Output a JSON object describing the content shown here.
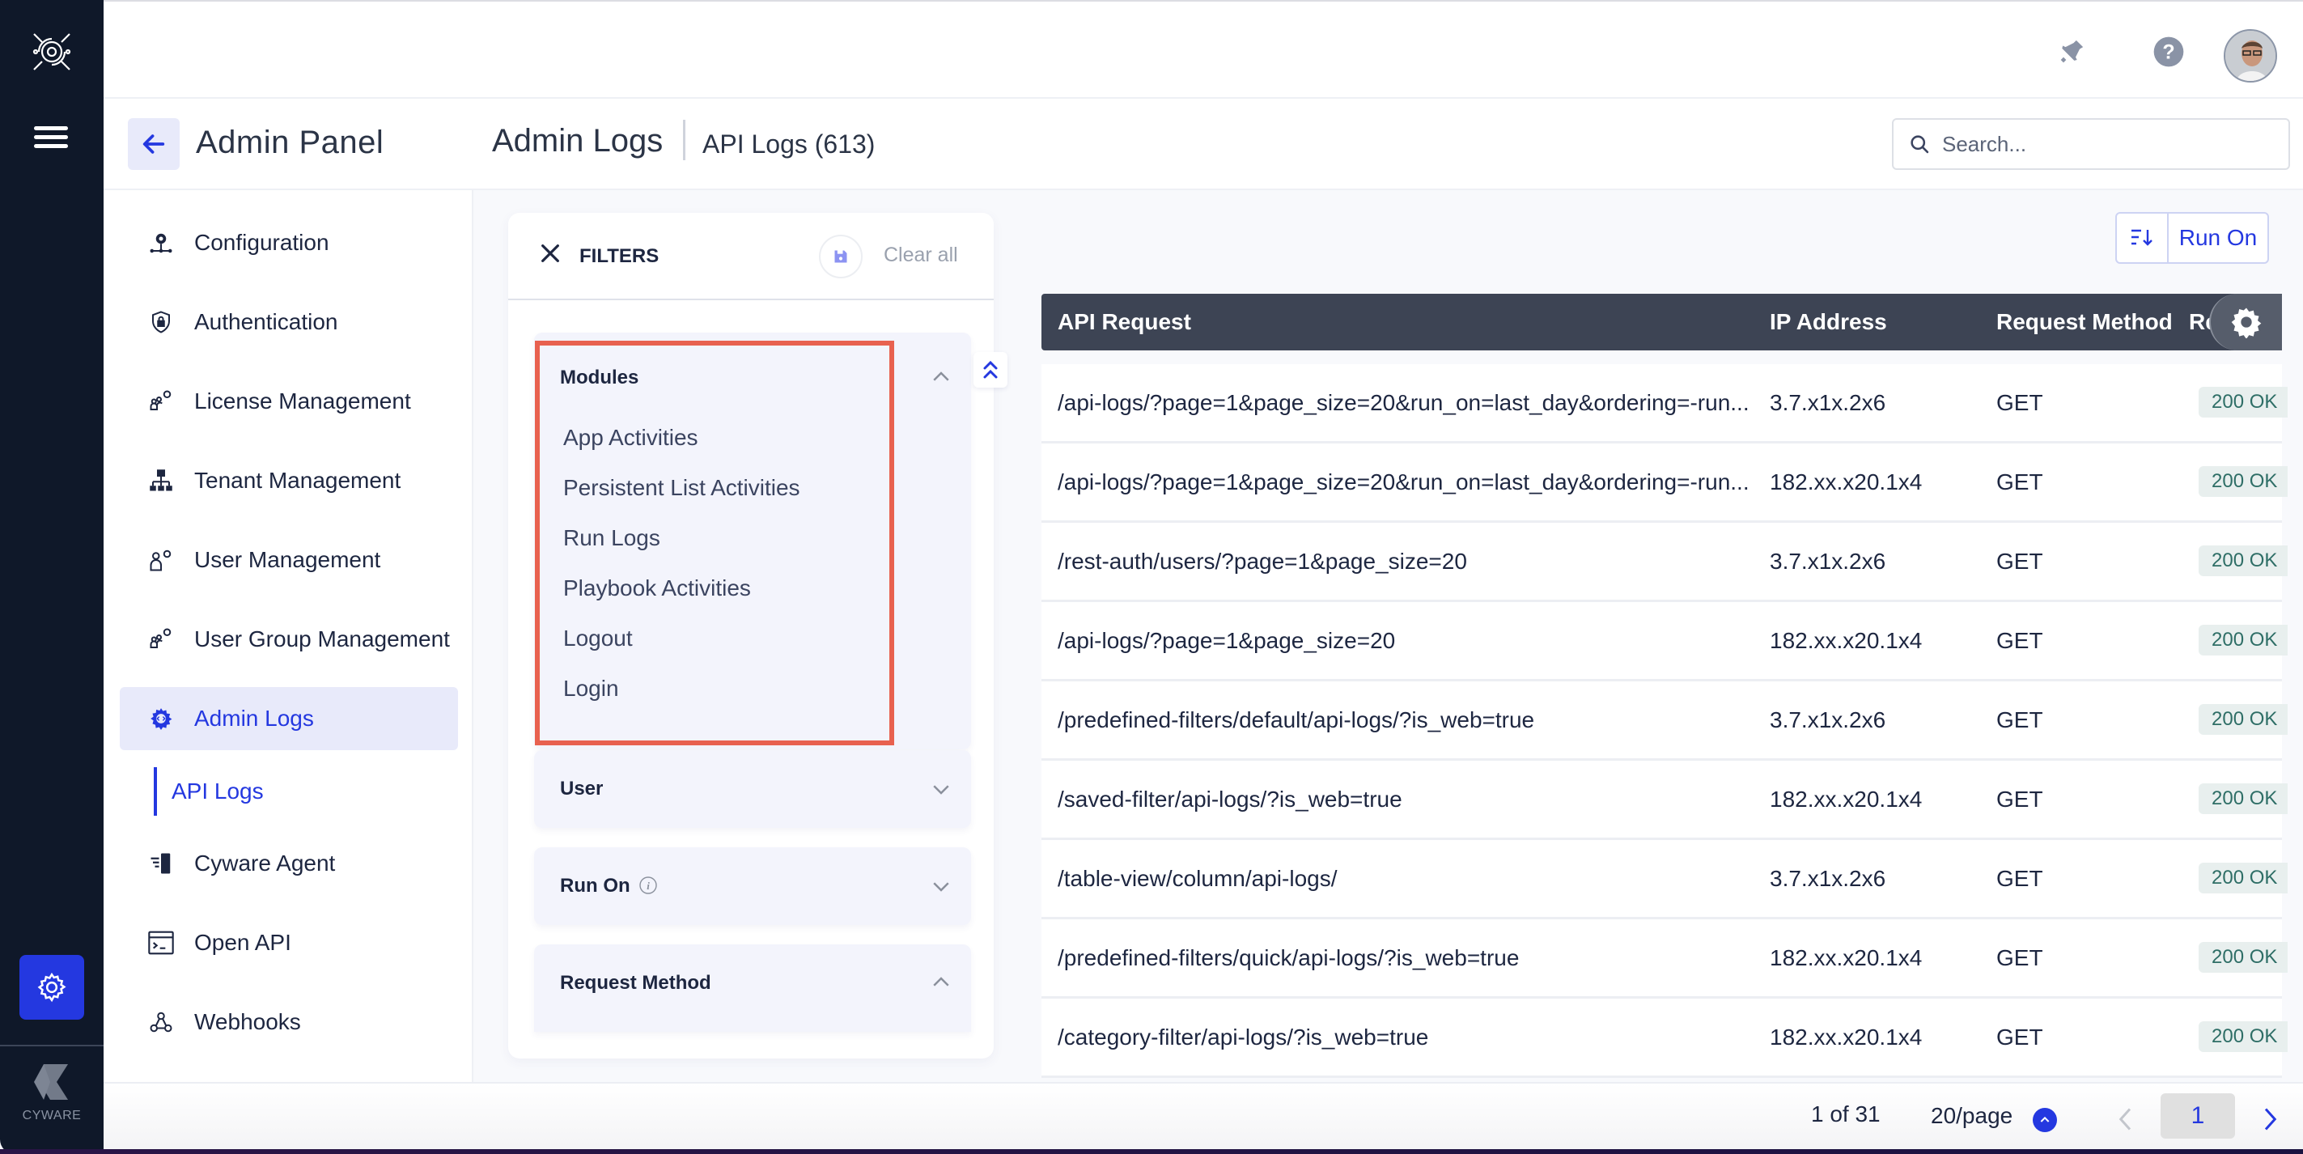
{
  "app": {
    "brand_name": "CYWARE",
    "icons": {
      "logo": "cyware-logo-icon",
      "menu": "hamburger-menu-icon",
      "settings": "gear-icon",
      "notifications": "bell-icon",
      "help": "question-circle-icon",
      "user": "user-avatar"
    }
  },
  "header": {
    "back_icon": "arrow-left-icon",
    "panel_title": "Admin Panel",
    "page_title": "Admin Logs",
    "page_subtitle": "API Logs (613)",
    "search": {
      "placeholder": "Search...",
      "value": ""
    }
  },
  "sidebar": {
    "items": [
      {
        "label": "Configuration",
        "icon": "network-gear-icon",
        "active": false
      },
      {
        "label": "Authentication",
        "icon": "shield-lock-icon",
        "active": false
      },
      {
        "label": "License Management",
        "icon": "users-gear-icon",
        "active": false
      },
      {
        "label": "Tenant Management",
        "icon": "hierarchy-icon",
        "active": false
      },
      {
        "label": "User Management",
        "icon": "user-gear-icon",
        "active": false
      },
      {
        "label": "User Group Management",
        "icon": "users-gear-icon",
        "active": false
      },
      {
        "label": "Admin Logs",
        "icon": "code-gear-icon",
        "active": true
      },
      {
        "label": "Cyware Agent",
        "icon": "agent-icon",
        "active": false
      },
      {
        "label": "Open API",
        "icon": "terminal-icon",
        "active": false
      },
      {
        "label": "Webhooks",
        "icon": "webhook-icon",
        "active": false
      }
    ],
    "sub_item": {
      "label": "API Logs",
      "active": true
    }
  },
  "filters": {
    "title": "FILTERS",
    "clear_all": "Clear all",
    "sections": [
      {
        "label": "Modules",
        "expanded": true,
        "options": [
          "App Activities",
          "Persistent List Activities",
          "Run Logs",
          "Playbook Activities",
          "Logout",
          "Login"
        ]
      },
      {
        "label": "User",
        "expanded": false
      },
      {
        "label": "Run On",
        "expanded": false,
        "has_info": true
      },
      {
        "label": "Request Method",
        "expanded": true
      }
    ]
  },
  "toolbar": {
    "run_on_label": "Run On"
  },
  "table": {
    "columns": [
      "API Request",
      "IP Address",
      "Request Method",
      "Re"
    ],
    "rows": [
      {
        "api_request": "/api-logs/?page=1&page_size=20&run_on=last_day&ordering=-run...",
        "ip": "3.7.x1x.2x6",
        "method": "GET",
        "status": "200 OK"
      },
      {
        "api_request": "/api-logs/?page=1&page_size=20&run_on=last_day&ordering=-run...",
        "ip": "182.xx.x20.1x4",
        "method": "GET",
        "status": "200 OK"
      },
      {
        "api_request": "/rest-auth/users/?page=1&page_size=20",
        "ip": "3.7.x1x.2x6",
        "method": "GET",
        "status": "200 OK"
      },
      {
        "api_request": "/api-logs/?page=1&page_size=20",
        "ip": "182.xx.x20.1x4",
        "method": "GET",
        "status": "200 OK"
      },
      {
        "api_request": "/predefined-filters/default/api-logs/?is_web=true",
        "ip": "3.7.x1x.2x6",
        "method": "GET",
        "status": "200 OK"
      },
      {
        "api_request": "/saved-filter/api-logs/?is_web=true",
        "ip": "182.xx.x20.1x4",
        "method": "GET",
        "status": "200 OK"
      },
      {
        "api_request": "/table-view/column/api-logs/",
        "ip": "3.7.x1x.2x6",
        "method": "GET",
        "status": "200 OK"
      },
      {
        "api_request": "/predefined-filters/quick/api-logs/?is_web=true",
        "ip": "182.xx.x20.1x4",
        "method": "GET",
        "status": "200 OK"
      },
      {
        "api_request": "/category-filter/api-logs/?is_web=true",
        "ip": "182.xx.x20.1x4",
        "method": "GET",
        "status": "200 OK"
      }
    ]
  },
  "pagination": {
    "page_info": "1 of 31",
    "per_page": "20/page",
    "current_page": "1"
  },
  "colors": {
    "accent": "#2438e0",
    "rail_bg": "#0f1829",
    "table_header_bg": "#3d4454",
    "status_ok_bg": "#e8efee",
    "status_ok_text": "#2e6e66",
    "highlight_border": "#e8614f"
  }
}
